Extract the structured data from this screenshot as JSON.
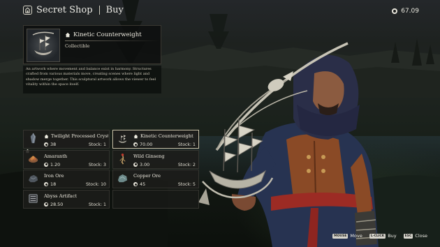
{
  "header": {
    "title": "Secret Shop",
    "mode": "Buy",
    "currency_value": "67.09"
  },
  "detail": {
    "name": "Kinetic Counterweight",
    "category": "Collectible",
    "description": "An artwork where movement and balance exist in harmony. Structures crafted from various materials move, creating scenes where light and shadow merge together. This sculptural artwork allows the viewer to feel vitality within the space itself."
  },
  "items": [
    {
      "name": "Twilight Processed Crysta",
      "price": "38",
      "stock": "Stock: 1",
      "icon": "crystal-icon",
      "home": true,
      "selected": false
    },
    {
      "name": "Kinetic Counterweight",
      "price": "70.00",
      "stock": "Stock: 1",
      "icon": "ship-sculpture-icon",
      "home": true,
      "selected": true
    },
    {
      "name": "Amaranth",
      "price": "1.20",
      "stock": "Stock: 3",
      "icon": "amaranth-icon",
      "home": false,
      "selected": false
    },
    {
      "name": "Wild Ginseng",
      "price": "3.00",
      "stock": "Stock: 2",
      "icon": "ginseng-icon",
      "home": false,
      "selected": false
    },
    {
      "name": "Iron Ore",
      "price": "18",
      "stock": "Stock: 10",
      "icon": "iron-ore-icon",
      "home": false,
      "selected": false
    },
    {
      "name": "Copper Ore",
      "price": "45",
      "stock": "Stock: 5",
      "icon": "copper-ore-icon",
      "home": false,
      "selected": false
    },
    {
      "name": "Abyss Artifact",
      "price": "28.50",
      "stock": "Stock: 1",
      "icon": "abyss-artifact-icon",
      "home": false,
      "selected": false
    }
  ],
  "hints": [
    {
      "key": "MOUSE",
      "label": "Move"
    },
    {
      "key": "L-CLICK",
      "label": "Buy"
    },
    {
      "key": "ESC",
      "label": "Close"
    }
  ],
  "colors": {
    "panel_bg": "#1c1c1a",
    "selected_border": "#cfc7ad",
    "text": "#eeeadf"
  }
}
